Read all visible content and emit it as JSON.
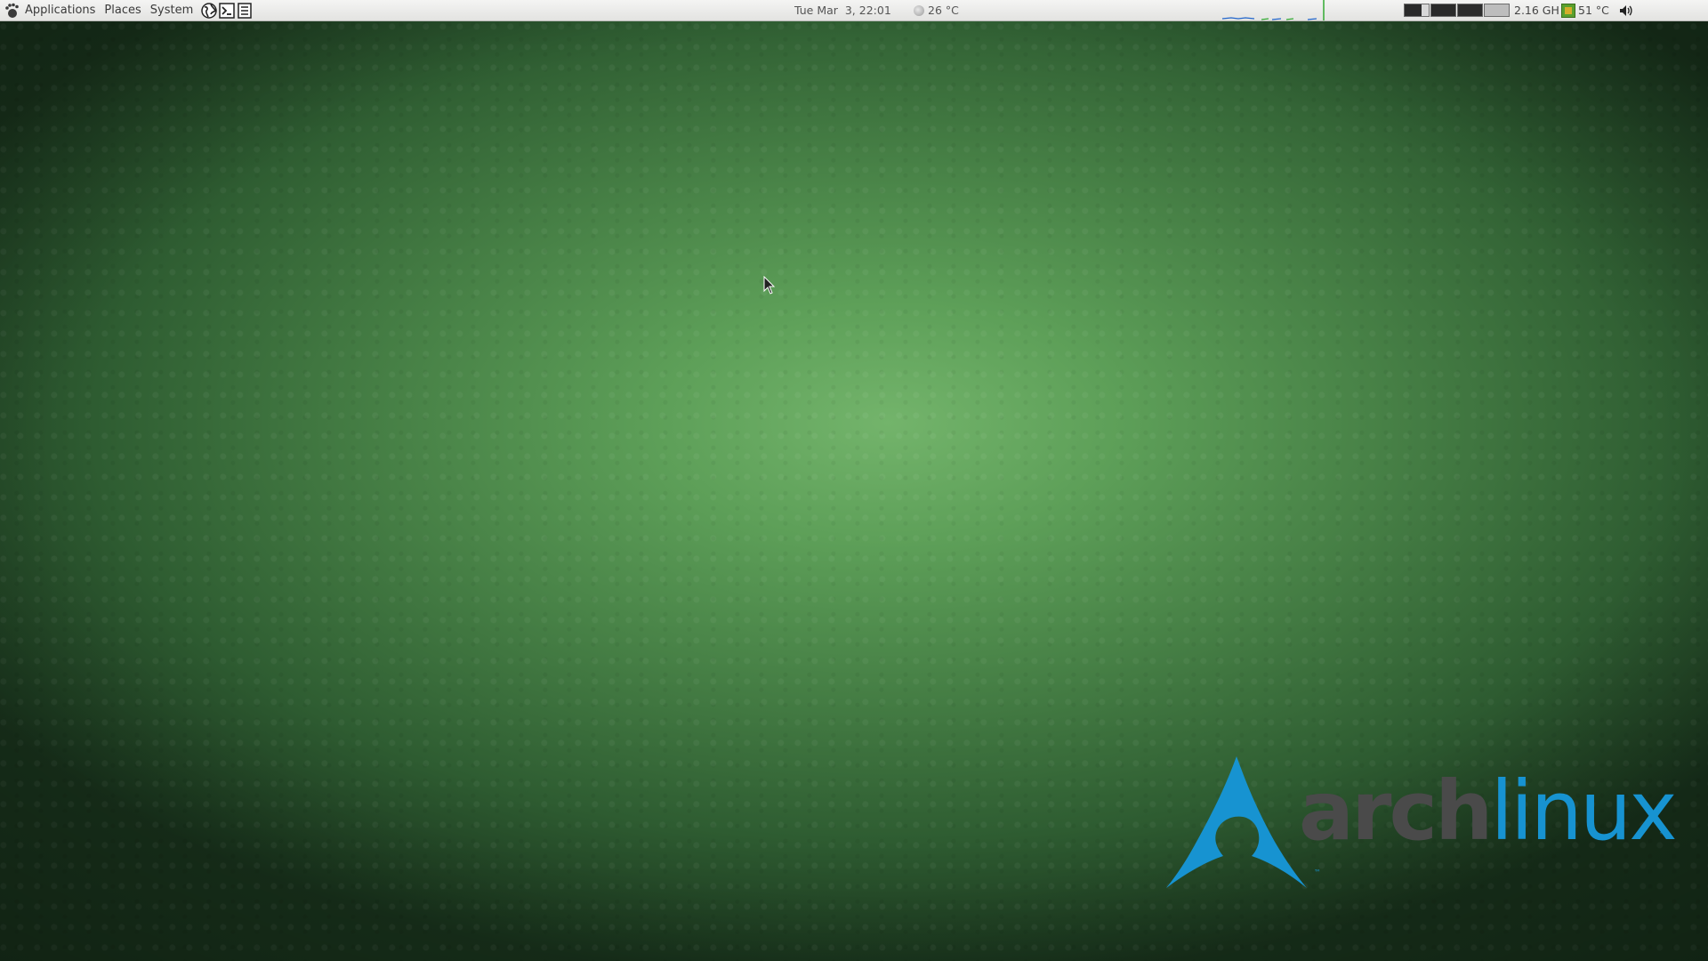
{
  "top_panel": {
    "menus": {
      "applications": "Applications",
      "places": "Places",
      "system": "System"
    },
    "launchers": [
      "web-browser-icon",
      "terminal-icon",
      "text-editor-icon"
    ],
    "clock": "Tue Mar  3, 22:01",
    "weather": "26 °C",
    "cpu_frequency": "2.16 GH",
    "cpu_temperature": "51 °C",
    "workspaces": [
      "workspace-1",
      "workspace-2",
      "workspace-3",
      "workspace-4"
    ],
    "colors": {
      "panel_bg": "#ececea",
      "netgraph_tx": "#2266cc",
      "netgraph_rx": "#33aa33"
    }
  },
  "wallpaper": {
    "logo": {
      "word_arch": "arch",
      "word_linux": "linux",
      "trademark": "™",
      "colors": {
        "arch_blue": "#1793d1",
        "arch_gray": "#4a4a4a"
      }
    },
    "colors": {
      "center": "#73b46b",
      "edge": "#172f1a"
    }
  }
}
